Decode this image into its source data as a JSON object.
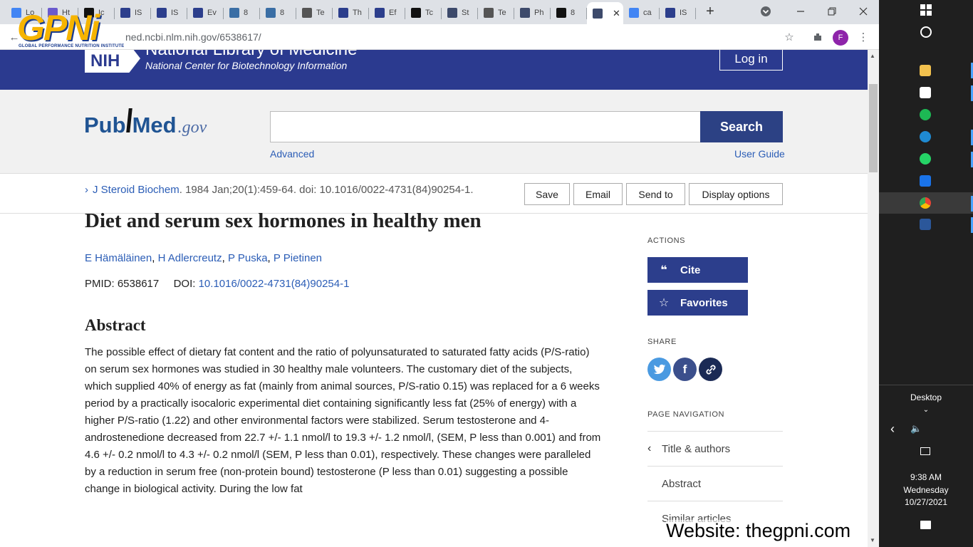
{
  "browser": {
    "tabs": [
      {
        "label": "Lo",
        "color": "#4285f4"
      },
      {
        "label": "Ht",
        "color": "#6a5acd"
      },
      {
        "label": "Ic",
        "color": "#111111"
      },
      {
        "label": "IS",
        "color": "#2c3e8c"
      },
      {
        "label": "IS",
        "color": "#2c3e8c"
      },
      {
        "label": "Ev",
        "color": "#2c3e8c"
      },
      {
        "label": "8",
        "color": "#3a6ea5"
      },
      {
        "label": "8",
        "color": "#3a6ea5"
      },
      {
        "label": "Te",
        "color": "#555555"
      },
      {
        "label": "Th",
        "color": "#2c3e8c"
      },
      {
        "label": "Ef",
        "color": "#2c3e8c"
      },
      {
        "label": "Tc",
        "color": "#111111"
      },
      {
        "label": "St",
        "color": "#3d4a6b"
      },
      {
        "label": "Te",
        "color": "#555555"
      },
      {
        "label": "Ph",
        "color": "#3d4a6b"
      },
      {
        "label": "8",
        "color": "#111111"
      },
      {
        "label": "",
        "color": "#3d4a6b"
      },
      {
        "label": "ca",
        "color": "#4285f4"
      },
      {
        "label": "IS",
        "color": "#2c3e8c"
      }
    ],
    "url": "ned.ncbi.nlm.nih.gov/6538617/",
    "profile_initial": "F"
  },
  "logo": {
    "text": "GPNi",
    "subtitle": "GLOBAL PERFORMANCE NUTRITION INSTITUTE"
  },
  "nih": {
    "logo_text": "NIH",
    "title": "National Library of Medicine",
    "subtitle": "National Center for Biotechnology Information",
    "login": "Log in"
  },
  "pubmed": {
    "logo_pub": "Pub",
    "logo_med": "Med",
    "logo_gov": ".gov",
    "search_value": "",
    "search_button": "Search",
    "advanced": "Advanced",
    "user_guide": "User Guide"
  },
  "actions": {
    "save": "Save",
    "email": "Email",
    "send_to": "Send to",
    "display_options": "Display options"
  },
  "article": {
    "journal": "J Steroid Biochem",
    "citation": ". 1984 Jan;20(1):459-64. doi: 10.1016/0022-4731(84)90254-1.",
    "title": "Diet and serum sex hormones in healthy men",
    "authors": [
      "E Hämäläinen",
      "H Adlercreutz",
      "P Puska",
      "P Pietinen"
    ],
    "pmid_label": "PMID: 6538617",
    "doi_label": "DOI:",
    "doi": "10.1016/0022-4731(84)90254-1",
    "abstract_heading": "Abstract",
    "abstract": "The possible effect of dietary fat content and the ratio of polyunsaturated to saturated fatty acids (P/S-ratio) on serum sex hormones was studied in 30 healthy male volunteers. The customary diet of the subjects, which supplied 40% of energy as fat (mainly from animal sources, P/S-ratio 0.15) was replaced for a 6 weeks period by a practically isocaloric experimental diet containing significantly less fat (25% of energy) with a higher P/S-ratio (1.22) and other environmental factors were stabilized. Serum testosterone and 4-androstenedione decreased from 22.7 +/- 1.1 nmol/l to 19.3 +/- 1.2 nmol/l, (SEM, P less than 0.001) and from 4.6 +/- 0.2 nmol/l to 4.3 +/- 0.2 nmol/l (SEM, P less than 0.01), respectively. These changes were paralleled by a reduction in serum free (non-protein bound) testosterone (P less than 0.01) suggesting a possible change in biological activity. During the low fat"
  },
  "sidebar": {
    "actions_heading": "ACTIONS",
    "cite": "Cite",
    "favorites": "Favorites",
    "share_heading": "SHARE",
    "page_nav_heading": "PAGE NAVIGATION",
    "nav_items": [
      "Title & authors",
      "Abstract",
      "Similar articles"
    ]
  },
  "website": "Website: thegpni.com",
  "taskbar": {
    "desktop_label": "Desktop",
    "time": "9:38 AM",
    "day": "Wednesday",
    "date": "10/27/2021"
  }
}
